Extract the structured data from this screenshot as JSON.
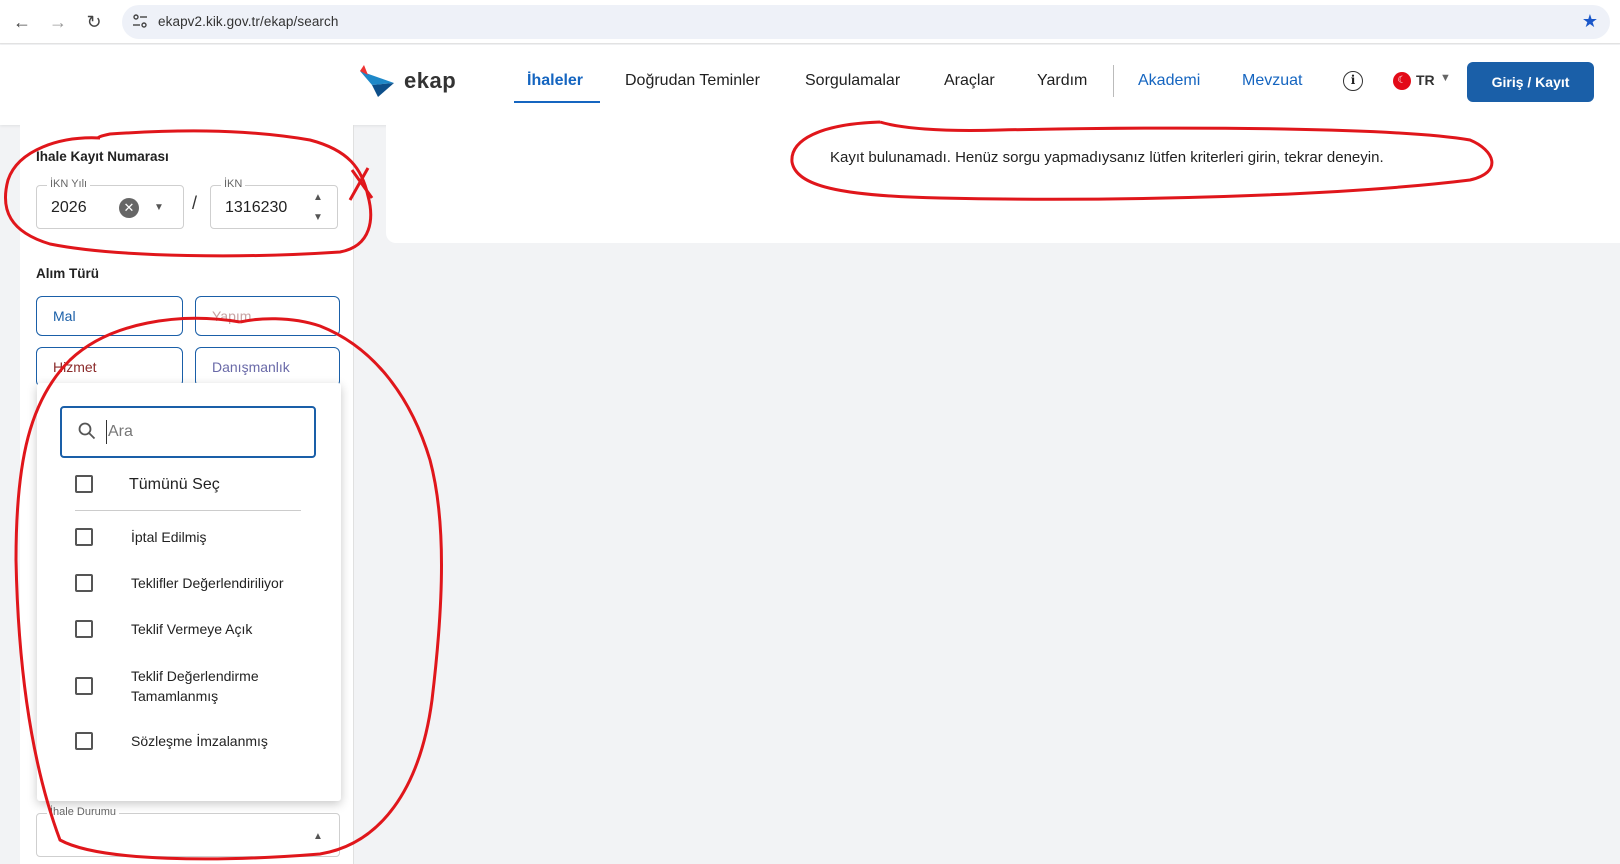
{
  "browser": {
    "url": "ekapv2.kik.gov.tr/ekap/search"
  },
  "header": {
    "logo_text": "ekap",
    "nav": [
      "İhaleler",
      "Doğrudan Teminler",
      "Sorgulamalar",
      "Araçlar",
      "Yardım"
    ],
    "nav_secondary": [
      "Akademi",
      "Mevzuat"
    ],
    "lang": "TR",
    "login_label": "Giriş / Kayıt"
  },
  "sidebar": {
    "ikn_section_title": "İhale Kayıt Numarası",
    "ikn_year_legend": "İKN Yılı",
    "ikn_year_value": "2026",
    "slash": "/",
    "ikn_legend": "İKN",
    "ikn_value": "1316230",
    "alim_section_title": "Alım Türü",
    "alim_chips": [
      "Mal",
      "Yapım",
      "Hizmet",
      "Danışmanlık"
    ],
    "status_legend": "İhale Durumu"
  },
  "dropdown": {
    "search_placeholder": "Ara",
    "select_all": "Tümünü Seç",
    "options": [
      "İptal Edilmiş",
      "Teklifler Değerlendiriliyor",
      "Teklif Vermeye Açık",
      "Teklif Değerlendirme Tamamlanmış",
      "Sözleşme İmzalanmış"
    ]
  },
  "main": {
    "empty_message": "Kayıt bulunamadı. Henüz sorgu yapmadıysanız lütfen kriterleri girin, tekrar deneyin."
  },
  "colors": {
    "brand": "#1a5fa8",
    "annotation": "#e0161b"
  }
}
